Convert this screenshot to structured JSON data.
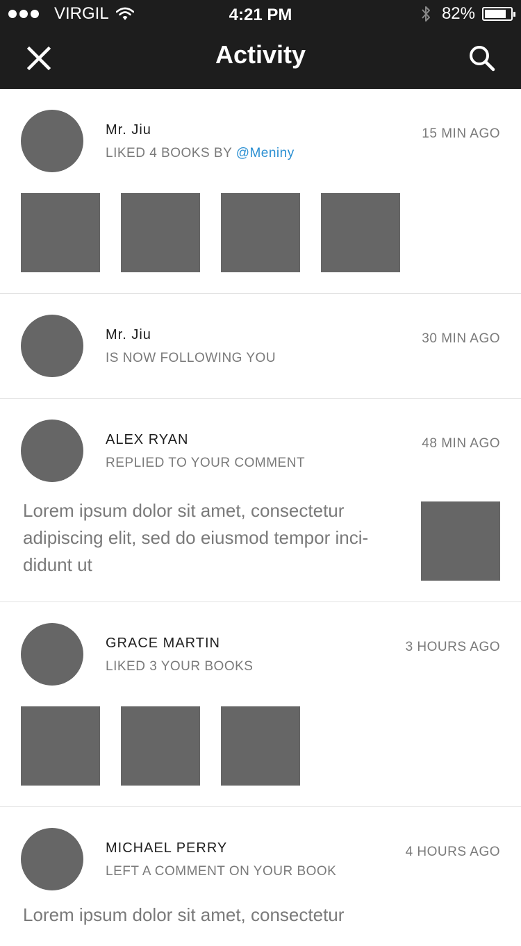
{
  "status_bar": {
    "carrier": "VIRGIL",
    "time": "4:21 PM",
    "battery": "82%",
    "battery_level": 0.82
  },
  "nav": {
    "title": "Activity",
    "left_icon": "close-icon",
    "right_icon": "search-icon"
  },
  "feed": [
    {
      "name": "Mr. Jiu",
      "action": "LIKED 4 BOOKS BY ",
      "mention": "@Meniny",
      "time": "15 MIN AGO",
      "thumbnail_count": 4
    },
    {
      "name": "Mr. Jiu",
      "action": "IS NOW FOLLOWING YOU",
      "time": "30 MIN AGO"
    },
    {
      "name": "ALEX RYAN",
      "action": "REPLIED TO YOUR COMMENT",
      "time": "48 MIN AGO",
      "comment": "Lorem ipsum dolor sit amet, consectetur adipiscing elit, sed do eiusmod tempor inci-didunt ut"
    },
    {
      "name": "GRACE MARTIN",
      "action": "LIKED 3 YOUR BOOKS",
      "time": "3 HOURS AGO",
      "thumbnail_count": 3
    },
    {
      "name": "MICHAEL PERRY",
      "action": "LEFT A COMMENT ON YOUR BOOK",
      "time": "4 HOURS AGO",
      "comment": "Lorem ipsum dolor sit amet, consectetur"
    }
  ],
  "colors": {
    "header_bg": "#1d1d1d",
    "placeholder": "#666666",
    "mention": "#2a8fd2",
    "muted_text": "#7a7a7a"
  }
}
